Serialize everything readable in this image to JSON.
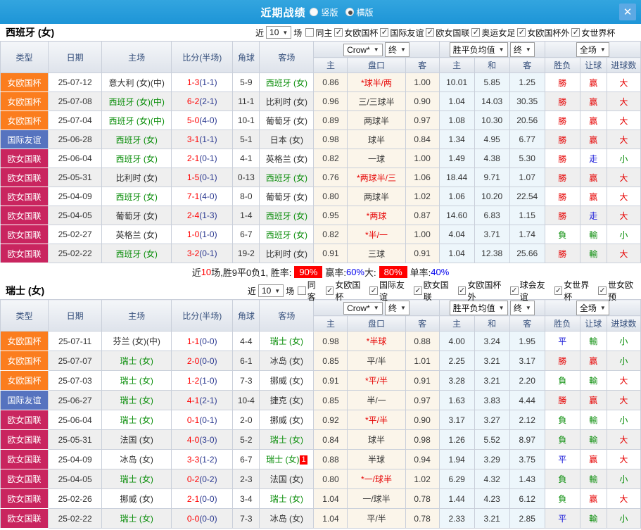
{
  "titlebar": {
    "title": "近期战绩",
    "radio_vertical": "竖版",
    "radio_horizontal": "横版"
  },
  "table_header": {
    "cols": [
      "类型",
      "日期",
      "主场",
      "比分(半场)",
      "角球",
      "客场"
    ],
    "sub": [
      "主",
      "盘口",
      "客",
      "主",
      "和",
      "客",
      "胜负",
      "让球",
      "进球数"
    ],
    "selects": {
      "odds_company": "Crow*",
      "odds_final": "终",
      "avg": "胜平负均值",
      "avg_final": "终",
      "scope": "全场"
    }
  },
  "type_colors": {
    "女欧国杯": "#FB7D1E",
    "国际友谊": "#5673BF",
    "欧女国联": "#C9255F"
  },
  "outcome_colors": {
    "勝": "#E60000",
    "負": "#0B8E0B",
    "平": "#1414D8",
    "赢": "#E60000",
    "走": "#1414D8",
    "輸": "#0B8E0B",
    "大": "#E60000",
    "小": "#0B8E0B"
  },
  "sections": [
    {
      "team": "西班牙 (女)",
      "filter": {
        "near": "近",
        "count": "10",
        "games": "场",
        "same": "同主",
        "same_checked": false,
        "comps": [
          "女欧国杯",
          "国际友谊",
          "欧女国联",
          "奥运女足",
          "女欧国杯外",
          "女世界杯"
        ]
      },
      "rows": [
        {
          "t": "女欧国杯",
          "d": "25-07-12",
          "h": "意大利 (女)(中)",
          "hg": 0,
          "s": "1-3",
          "ht": "1-1",
          "c": "5-9",
          "a": "西班牙 (女)",
          "ag": 1,
          "o1": "0.86",
          "hc": "*球半/两",
          "hr": 1,
          "o2": "1.00",
          "m1": "10.01",
          "m2": "5.85",
          "m3": "1.25",
          "r": "勝",
          "lb": "赢",
          "g": "大"
        },
        {
          "t": "女欧国杯",
          "d": "25-07-08",
          "h": "西班牙 (女)(中)",
          "hg": 1,
          "s": "6-2",
          "ht": "2-1",
          "c": "11-1",
          "a": "比利时 (女)",
          "ag": 0,
          "o1": "0.96",
          "hc": "三/三球半",
          "hr": 0,
          "o2": "0.90",
          "m1": "1.04",
          "m2": "14.03",
          "m3": "30.35",
          "r": "勝",
          "lb": "赢",
          "g": "大"
        },
        {
          "t": "女欧国杯",
          "d": "25-07-04",
          "h": "西班牙 (女)(中)",
          "hg": 1,
          "s": "5-0",
          "ht": "4-0",
          "c": "10-1",
          "a": "葡萄牙 (女)",
          "ag": 0,
          "o1": "0.89",
          "hc": "两球半",
          "hr": 0,
          "o2": "0.97",
          "m1": "1.08",
          "m2": "10.30",
          "m3": "20.56",
          "r": "勝",
          "lb": "赢",
          "g": "大"
        },
        {
          "t": "国际友谊",
          "d": "25-06-28",
          "h": "西班牙 (女)",
          "hg": 1,
          "s": "3-1",
          "ht": "1-1",
          "c": "5-1",
          "a": "日本 (女)",
          "ag": 0,
          "o1": "0.98",
          "hc": "球半",
          "hr": 0,
          "o2": "0.84",
          "m1": "1.34",
          "m2": "4.95",
          "m3": "6.77",
          "r": "勝",
          "lb": "赢",
          "g": "大"
        },
        {
          "t": "欧女国联",
          "d": "25-06-04",
          "h": "西班牙 (女)",
          "hg": 1,
          "s": "2-1",
          "ht": "0-1",
          "c": "4-1",
          "a": "英格兰 (女)",
          "ag": 0,
          "o1": "0.82",
          "hc": "一球",
          "hr": 0,
          "o2": "1.00",
          "m1": "1.49",
          "m2": "4.38",
          "m3": "5.30",
          "r": "勝",
          "lb": "走",
          "g": "小"
        },
        {
          "t": "欧女国联",
          "d": "25-05-31",
          "h": "比利时 (女)",
          "hg": 0,
          "s": "1-5",
          "ht": "0-1",
          "c": "0-13",
          "a": "西班牙 (女)",
          "ag": 1,
          "o1": "0.76",
          "hc": "*两球半/三",
          "hr": 1,
          "o2": "1.06",
          "m1": "18.44",
          "m2": "9.71",
          "m3": "1.07",
          "r": "勝",
          "lb": "赢",
          "g": "大"
        },
        {
          "t": "欧女国联",
          "d": "25-04-09",
          "h": "西班牙 (女)",
          "hg": 1,
          "s": "7-1",
          "ht": "4-0",
          "c": "8-0",
          "a": "葡萄牙 (女)",
          "ag": 0,
          "o1": "0.80",
          "hc": "两球半",
          "hr": 0,
          "o2": "1.02",
          "m1": "1.06",
          "m2": "10.20",
          "m3": "22.54",
          "r": "勝",
          "lb": "赢",
          "g": "大"
        },
        {
          "t": "欧女国联",
          "d": "25-04-05",
          "h": "葡萄牙 (女)",
          "hg": 0,
          "s": "2-4",
          "ht": "1-3",
          "c": "1-4",
          "a": "西班牙 (女)",
          "ag": 1,
          "o1": "0.95",
          "hc": "*两球",
          "hr": 1,
          "o2": "0.87",
          "m1": "14.60",
          "m2": "6.83",
          "m3": "1.15",
          "r": "勝",
          "lb": "走",
          "g": "大"
        },
        {
          "t": "欧女国联",
          "d": "25-02-27",
          "h": "英格兰 (女)",
          "hg": 0,
          "s": "1-0",
          "ht": "1-0",
          "c": "6-7",
          "a": "西班牙 (女)",
          "ag": 1,
          "o1": "0.82",
          "hc": "*半/一",
          "hr": 1,
          "o2": "1.00",
          "m1": "4.04",
          "m2": "3.71",
          "m3": "1.74",
          "r": "負",
          "lb": "輸",
          "g": "小"
        },
        {
          "t": "欧女国联",
          "d": "25-02-22",
          "h": "西班牙 (女)",
          "hg": 1,
          "s": "3-2",
          "ht": "0-1",
          "c": "19-2",
          "a": "比利时 (女)",
          "ag": 0,
          "o1": "0.91",
          "hc": "三球",
          "hr": 0,
          "o2": "0.91",
          "m1": "1.04",
          "m2": "12.38",
          "m3": "25.66",
          "r": "勝",
          "lb": "輸",
          "g": "大"
        }
      ],
      "summary_parts": [
        {
          "t": "近",
          "s": "p"
        },
        {
          "t": "10",
          "s": "r"
        },
        {
          "t": "场,胜9平0负1, 胜率:",
          "s": "p"
        },
        {
          "t": "90%",
          "s": "b"
        },
        {
          "t": "赢率:",
          "s": "p"
        },
        {
          "t": "60%",
          "s": "u"
        },
        {
          "t": " 大:",
          "s": "p"
        },
        {
          "t": "80%",
          "s": "b"
        },
        {
          "t": "单率:",
          "s": "p"
        },
        {
          "t": "40%",
          "s": "u"
        }
      ]
    },
    {
      "team": "瑞士 (女)",
      "filter": {
        "near": "近",
        "count": "10",
        "games": "场",
        "same": "同客",
        "same_checked": false,
        "comps": [
          "女欧国杯",
          "国际友谊",
          "欧女国联",
          "女欧国杯外",
          "球会友谊",
          "女世界杯",
          "世女欧预"
        ]
      },
      "rows": [
        {
          "t": "女欧国杯",
          "d": "25-07-11",
          "h": "芬兰 (女)(中)",
          "hg": 0,
          "s": "1-1",
          "ht": "0-0",
          "c": "4-4",
          "a": "瑞士 (女)",
          "ag": 1,
          "o1": "0.98",
          "hc": "*半球",
          "hr": 1,
          "o2": "0.88",
          "m1": "4.00",
          "m2": "3.24",
          "m3": "1.95",
          "r": "平",
          "lb": "輸",
          "g": "小"
        },
        {
          "t": "女欧国杯",
          "d": "25-07-07",
          "h": "瑞士 (女)",
          "hg": 1,
          "s": "2-0",
          "ht": "0-0",
          "c": "6-1",
          "a": "冰岛 (女)",
          "ag": 0,
          "o1": "0.85",
          "hc": "平/半",
          "hr": 0,
          "o2": "1.01",
          "m1": "2.25",
          "m2": "3.21",
          "m3": "3.17",
          "r": "勝",
          "lb": "赢",
          "g": "小"
        },
        {
          "t": "女欧国杯",
          "d": "25-07-03",
          "h": "瑞士 (女)",
          "hg": 1,
          "s": "1-2",
          "ht": "1-0",
          "c": "7-3",
          "a": "挪威 (女)",
          "ag": 0,
          "o1": "0.91",
          "hc": "*平/半",
          "hr": 1,
          "o2": "0.91",
          "m1": "3.28",
          "m2": "3.21",
          "m3": "2.20",
          "r": "負",
          "lb": "輸",
          "g": "大"
        },
        {
          "t": "国际友谊",
          "d": "25-06-27",
          "h": "瑞士 (女)",
          "hg": 1,
          "s": "4-1",
          "ht": "2-1",
          "c": "10-4",
          "a": "捷克 (女)",
          "ag": 0,
          "o1": "0.85",
          "hc": "半/一",
          "hr": 0,
          "o2": "0.97",
          "m1": "1.63",
          "m2": "3.83",
          "m3": "4.44",
          "r": "勝",
          "lb": "赢",
          "g": "大"
        },
        {
          "t": "欧女国联",
          "d": "25-06-04",
          "h": "瑞士 (女)",
          "hg": 1,
          "s": "0-1",
          "ht": "0-1",
          "c": "2-0",
          "a": "挪威 (女)",
          "ag": 0,
          "o1": "0.92",
          "hc": "*平/半",
          "hr": 1,
          "o2": "0.90",
          "m1": "3.17",
          "m2": "3.27",
          "m3": "2.12",
          "r": "負",
          "lb": "輸",
          "g": "小"
        },
        {
          "t": "欧女国联",
          "d": "25-05-31",
          "h": "法国 (女)",
          "hg": 0,
          "s": "4-0",
          "ht": "3-0",
          "c": "5-2",
          "a": "瑞士 (女)",
          "ag": 1,
          "o1": "0.84",
          "hc": "球半",
          "hr": 0,
          "o2": "0.98",
          "m1": "1.26",
          "m2": "5.52",
          "m3": "8.97",
          "r": "負",
          "lb": "輸",
          "g": "大"
        },
        {
          "t": "欧女国联",
          "d": "25-04-09",
          "h": "冰岛 (女)",
          "hg": 0,
          "s": "3-3",
          "ht": "1-2",
          "c": "6-7",
          "a": "瑞士 (女)",
          "ag": 1,
          "ab": "1",
          "o1": "0.88",
          "hc": "半球",
          "hr": 0,
          "o2": "0.94",
          "m1": "1.94",
          "m2": "3.29",
          "m3": "3.75",
          "r": "平",
          "lb": "赢",
          "g": "大"
        },
        {
          "t": "欧女国联",
          "d": "25-04-05",
          "h": "瑞士 (女)",
          "hg": 1,
          "s": "0-2",
          "ht": "0-2",
          "c": "2-3",
          "a": "法国 (女)",
          "ag": 0,
          "o1": "0.80",
          "hc": "*一/球半",
          "hr": 1,
          "o2": "1.02",
          "m1": "6.29",
          "m2": "4.32",
          "m3": "1.43",
          "r": "負",
          "lb": "輸",
          "g": "小"
        },
        {
          "t": "欧女国联",
          "d": "25-02-26",
          "h": "挪威 (女)",
          "hg": 0,
          "s": "2-1",
          "ht": "0-0",
          "c": "3-4",
          "a": "瑞士 (女)",
          "ag": 1,
          "o1": "1.04",
          "hc": "一/球半",
          "hr": 0,
          "o2": "0.78",
          "m1": "1.44",
          "m2": "4.23",
          "m3": "6.12",
          "r": "負",
          "lb": "赢",
          "g": "大"
        },
        {
          "t": "欧女国联",
          "d": "25-02-22",
          "h": "瑞士 (女)",
          "hg": 1,
          "s": "0-0",
          "ht": "0-0",
          "c": "7-3",
          "a": "冰岛 (女)",
          "ag": 0,
          "o1": "1.04",
          "hc": "平/半",
          "hr": 0,
          "o2": "0.78",
          "m1": "2.33",
          "m2": "3.21",
          "m3": "2.85",
          "r": "平",
          "lb": "輸",
          "g": "小"
        }
      ]
    }
  ]
}
